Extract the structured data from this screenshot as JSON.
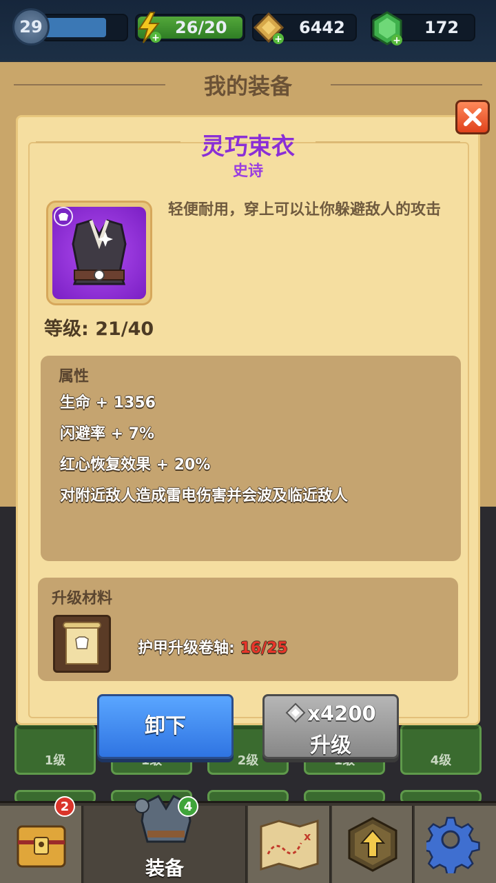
{
  "top_bar": {
    "player_level": "29",
    "energy": "26/20",
    "coins": "6442",
    "gems": "172"
  },
  "page": {
    "title": "我的装备"
  },
  "item": {
    "name": "灵巧束衣",
    "rarity": "史诗",
    "description": "轻便耐用，穿上可以让你躲避敌人的攻击",
    "level_text": "等级: 21/40"
  },
  "attributes": {
    "heading": "属性",
    "lines": [
      "生命 + 1356",
      "闪避率 + 7%",
      "红心恢复效果 + 20%",
      "对附近敌人造成雷电伤害并会波及临近敌人"
    ]
  },
  "materials": {
    "heading": "升级材料",
    "name": "护甲升级卷轴: ",
    "count": "16/25"
  },
  "buttons": {
    "unequip": "卸下",
    "upgrade_cost": "x4200",
    "upgrade": "升级"
  },
  "background_slots": {
    "levels": [
      "1级",
      "1级",
      "2级",
      "1级",
      "4级"
    ]
  },
  "bottom_nav": {
    "chest_badge": "2",
    "equipment_badge": "4",
    "equipment_label": "装备"
  },
  "colors": {
    "rarity_epic": "#8a2fd6",
    "insufficient": "#e8352a",
    "primary_button": "#2f74e2"
  }
}
